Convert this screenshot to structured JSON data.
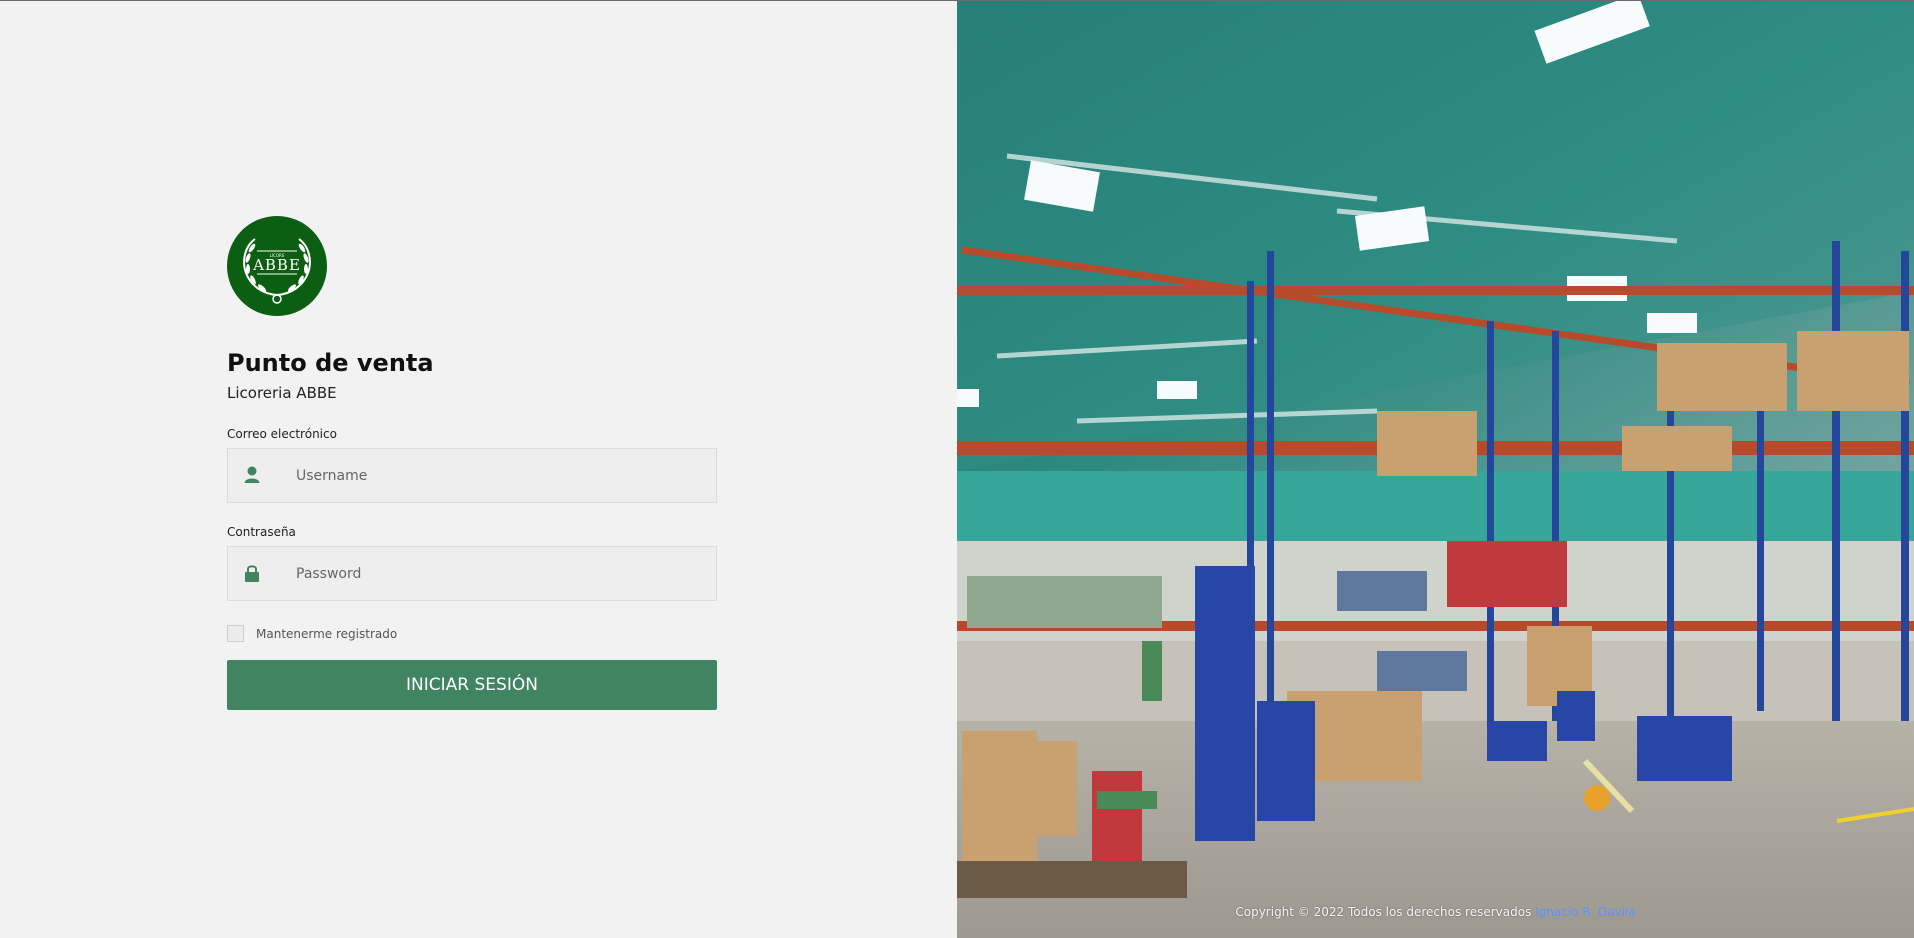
{
  "brand": {
    "logo_text": "ABBE",
    "logo_small_text": "LICORS",
    "app_title": "Punto de venta",
    "store_name": "Licoreria ABBE",
    "logo_color": "#0b5e12"
  },
  "login": {
    "email_label": "Correo electrónico",
    "username_placeholder": "Username",
    "password_label": "Contraseña",
    "password_placeholder": "Password",
    "remember_label": "Mantenerme registrado",
    "remember_checked": false,
    "submit_label": "INICIAR SESIÓN",
    "accent_color": "#408462",
    "icons": {
      "username": "user-icon",
      "password": "lock-icon"
    }
  },
  "hero_image": {
    "subject": "warehouse",
    "icon": "warehouse-photo"
  },
  "footer": {
    "copyright_text": "Copyright © 2022 Todos los derechos reservados",
    "author_link": "Ignacio R. Davila"
  }
}
